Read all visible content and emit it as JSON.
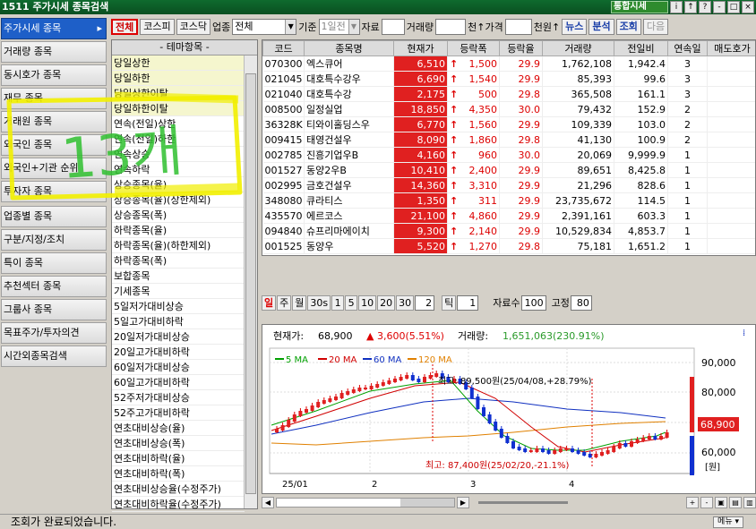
{
  "window": {
    "title": "1511 주가시세 종목검색",
    "combo": "통합시세",
    "buttons": [
      "i",
      "↑",
      "?",
      "-",
      "□",
      "×"
    ]
  },
  "left_menu": [
    "주가시세 종목",
    "거래량 종목",
    "동시호가 종목",
    "재무 종목",
    "거래원 종목",
    "외국인 종목",
    "외국인+기관 순위",
    "투자자 종목",
    "업종별 종목",
    "구분/지정/조치",
    "특이 종목",
    "추천섹터 종목",
    "그룹사 종목",
    "목표주가/투자의견",
    "시간외종목검색"
  ],
  "toolbar": {
    "all_label": "전체",
    "kospi_label": "코스피",
    "kosdaq_label": "코스닥",
    "sector_label": "업종",
    "sector_value": "전체",
    "base_label": "기준",
    "base_value": "1일전",
    "data_label": "자료",
    "volume_label": "거래량",
    "price_label": "천↑가격",
    "price_unit": "천원↑",
    "news_label": "뉴스",
    "analysis_label": "분석",
    "query_label": "조회",
    "next_label": "다음"
  },
  "theme": {
    "header": "-    테마항목    -",
    "items": [
      "당일상한",
      "당일하한",
      "당일상한이탈",
      "당일하한이탈",
      "연속(전일)상한",
      "연속(전일)하한",
      "연속상승",
      "연속하락",
      "상승종목(율)",
      "상승종목(율)(상한제외)",
      "상승종목(폭)",
      "하락종목(율)",
      "하락종목(율)(하한제외)",
      "하락종목(폭)",
      "보합종목",
      "기세종목",
      "5일저가대비상승",
      "5일고가대비하락",
      "20일저가대비상승",
      "20일고가대비하락",
      "60일저가대비상승",
      "60일고가대비하락",
      "52주저가대비상승",
      "52주고가대비하락",
      "연초대비상승(율)",
      "연초대비상승(폭)",
      "연초대비하락(율)",
      "연초대비하락(폭)",
      "연초대비상승율(수정주가)",
      "연초대비하락율(수정주가)"
    ]
  },
  "grid": {
    "headers": [
      "코드",
      "종목명",
      "현재가",
      "등락폭",
      "등락율",
      "거래량",
      "전일비",
      "연속일",
      "매도호가"
    ],
    "rows": [
      [
        "070300",
        "엑스큐어",
        "6,510",
        "1,500",
        "29.9",
        "1,762,108",
        "1,942.4",
        "3"
      ],
      [
        "021045",
        "대호특수강우",
        "6,690",
        "1,540",
        "29.9",
        "85,393",
        "99.6",
        "3"
      ],
      [
        "021040",
        "대호특수강",
        "2,175",
        "500",
        "29.8",
        "365,508",
        "161.1",
        "3"
      ],
      [
        "008500",
        "일정실업",
        "18,850",
        "4,350",
        "30.0",
        "79,432",
        "152.9",
        "2"
      ],
      [
        "36328K",
        "티와이홀딩스우",
        "6,770",
        "1,560",
        "29.9",
        "109,339",
        "103.0",
        "2"
      ],
      [
        "009415",
        "태영건설우",
        "8,090",
        "1,860",
        "29.8",
        "41,130",
        "100.9",
        "2"
      ],
      [
        "002785",
        "진흥기업우B",
        "4,160",
        "960",
        "30.0",
        "20,069",
        "9,999.9",
        "1"
      ],
      [
        "001527",
        "동양2우B",
        "10,410",
        "2,400",
        "29.9",
        "89,651",
        "8,425.8",
        "1"
      ],
      [
        "002995",
        "금호건설우",
        "14,360",
        "3,310",
        "29.9",
        "21,296",
        "828.6",
        "1"
      ],
      [
        "348080",
        "큐라티스",
        "1,350",
        "311",
        "29.9",
        "23,735,672",
        "114.5",
        "1"
      ],
      [
        "435570",
        "에르코스",
        "21,100",
        "4,860",
        "29.9",
        "2,391,161",
        "603.3",
        "1"
      ],
      [
        "094840",
        "슈프리마에이치",
        "9,300",
        "2,140",
        "29.9",
        "10,529,834",
        "4,853.7",
        "1"
      ],
      [
        "001525",
        "동양우",
        "5,520",
        "1,270",
        "29.8",
        "75,181",
        "1,651.2",
        "1"
      ]
    ]
  },
  "chart_ctrl": {
    "periods": [
      "일",
      "주",
      "월",
      "30s",
      "1",
      "5",
      "10",
      "20",
      "30"
    ],
    "period_input": "2",
    "tick_label": "틱",
    "tick_value": "1",
    "count_label": "자료수",
    "count_value": "100",
    "fixed_label": "고정",
    "fixed_value": "80"
  },
  "chart_info": {
    "current_label": "현재가:",
    "current_value": "68,900",
    "change": "▲ 3,600(5.51%)",
    "volume_label": "거래량:",
    "volume_value": "1,651,063(230.91%)",
    "ma_labels": [
      "5 MA",
      "20 MA",
      "60 MA",
      "120 MA"
    ],
    "ma_colors": [
      "#00a000",
      "#d00000",
      "#1030c0",
      "#e08000"
    ],
    "high_annot": "최고: 89,500원(25/04/08,+28.79%)",
    "low_annot": "최고: 87,400원(25/02/20,-21.1%)",
    "x_labels": [
      "25/01",
      "2",
      "3",
      "4"
    ],
    "y_labels": [
      "90,000",
      "80,000",
      "70,000",
      "60,000"
    ],
    "unit": "[원]",
    "price_tag": "68,900"
  },
  "annotation": {
    "handwriting": "13개"
  },
  "status": {
    "text": "조회가 완료되었습니다.",
    "menu": "메뉴 ▾"
  }
}
